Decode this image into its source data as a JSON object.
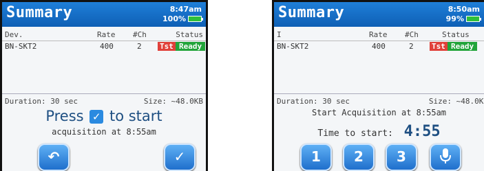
{
  "left": {
    "title": "Summary",
    "time": "8:47am",
    "battery": "100%",
    "columns": {
      "dev": "Dev.",
      "rate": "Rate",
      "nch": "#Ch",
      "status": "Status"
    },
    "row": {
      "dev": "BN-SKT2",
      "rate": "400",
      "nch": "2",
      "tst": "Tst",
      "status": "Ready"
    },
    "duration": "Duration: 30 sec",
    "size": "Size: ~48.0KB",
    "press": "Press",
    "to_start": "to start",
    "check_glyph": "✓",
    "acq_msg": "acquisition at 8:55am",
    "buttons": {
      "back": "↶",
      "confirm": "✓"
    }
  },
  "right": {
    "title": "Summary",
    "time": "8:50am",
    "battery": "99%",
    "columns": {
      "dev": "I",
      "rate": "Rate",
      "nch": "#Ch",
      "status": "Status"
    },
    "row": {
      "dev": "BN-SKT2",
      "rate": "400",
      "nch": "2",
      "tst": "Tst",
      "status": "Ready"
    },
    "duration": "Duration: 30 sec",
    "size": "Size: ~48.0KB",
    "start_acq": "Start Acquisition at 8:55am",
    "time_to_start_label": "Time to start:",
    "countdown": "4:55",
    "buttons": {
      "b1": "1",
      "b2": "2",
      "b3": "3"
    }
  },
  "colors": {
    "titlebar": "#1a73c9",
    "tst": "#e0403a",
    "ready": "#22a43a",
    "button": "#2a85e0"
  }
}
